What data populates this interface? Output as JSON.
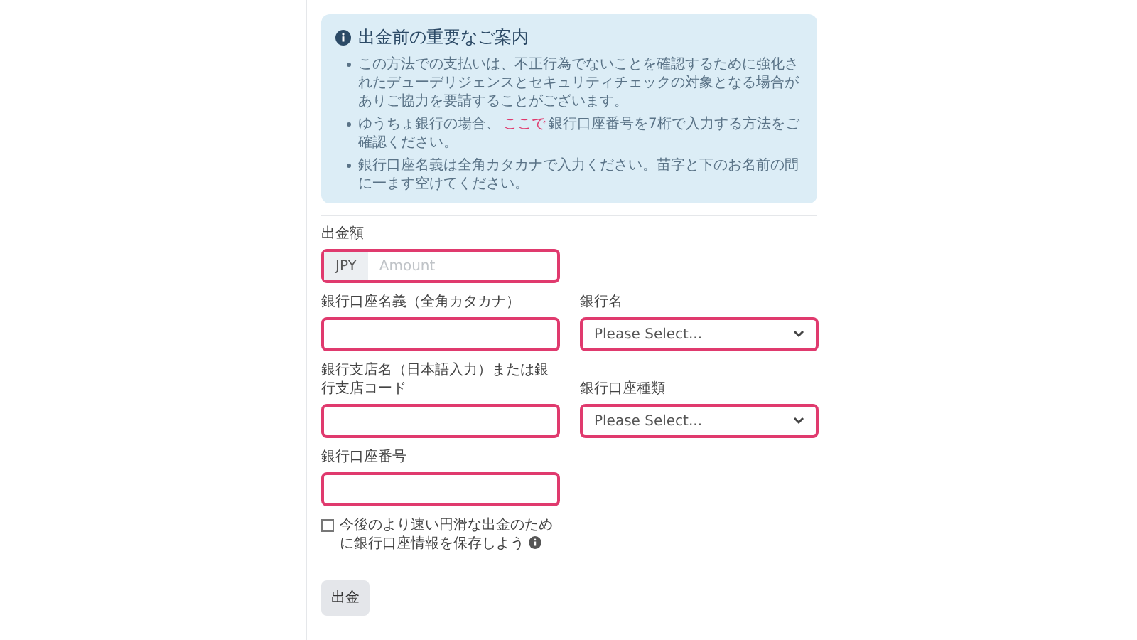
{
  "notice": {
    "title": "出金前の重要なご案内",
    "items": [
      {
        "text": "この方法での支払いは、不正行為でないことを確認するために強化されたデューデリジェンスとセキュリティチェックの対象となる場合がありご協力を要請することがございます。"
      },
      {
        "before": "ゆうちょ銀行の場合、",
        "link": "ここで",
        "after": "銀行口座番号を7桁で入力する方法をご確認ください。"
      },
      {
        "text": "銀行口座名義は全角カタカナで入力ください。苗字と下のお名前の間に一ます空けてください。"
      }
    ]
  },
  "fields": [
    {
      "kind": "amount",
      "label": "出金額",
      "prefix": "JPY",
      "placeholder": "Amount",
      "highlighted": true
    },
    {
      "kind": "text",
      "label": "銀行口座名義（全角カタカナ）",
      "highlighted": true
    },
    {
      "kind": "select",
      "label": "銀行名",
      "value": "Please Select...",
      "highlighted": true
    },
    {
      "kind": "text",
      "label": "銀行支店名（日本語入力）または銀行支店コード",
      "highlighted": true
    },
    {
      "kind": "select",
      "label": "銀行口座種類",
      "value": "Please Select...",
      "highlighted": true
    },
    {
      "kind": "text",
      "label": "銀行口座番号",
      "highlighted": true
    }
  ],
  "save_option": {
    "label": "今後のより速い円滑な出金のために銀行口座情報を保存しよう",
    "checked": false
  },
  "submit": "出金"
}
